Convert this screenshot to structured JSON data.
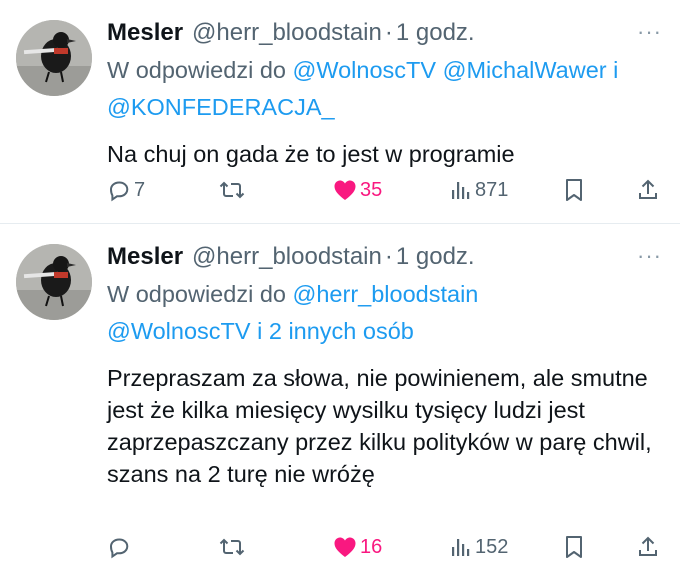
{
  "tweets": [
    {
      "author_name": "Mesler",
      "handle": "@herr_bloodstain",
      "separator": "·",
      "time": "1 godz.",
      "more_label": "···",
      "reply_prefix": "W odpowiedzi do ",
      "reply_mentions_line1": "@WolnoscTV @MichalWawer i",
      "reply_mentions_line2": "@KONFEDERACJA_",
      "text": "Na chuj on gada że to jest w programie",
      "reply_count": "7",
      "retweet_count": "",
      "like_count": "35",
      "view_count": "871",
      "liked": true
    },
    {
      "author_name": "Mesler",
      "handle": "@herr_bloodstain",
      "separator": "·",
      "time": "1 godz.",
      "more_label": "···",
      "reply_prefix": "W odpowiedzi do ",
      "reply_mentions_line1": "@herr_bloodstain",
      "reply_mentions_line2": "@WolnoscTV i 2 innych osób",
      "text": "Przepraszam za słowa, nie powinienem, ale smutne jest że kilka miesięcy wysilku tysięcy ludzi  jest zaprzepaszczany przez kilku polityków w parę chwil, szans na 2 turę nie wróżę",
      "reply_count": "",
      "retweet_count": "",
      "like_count": "16",
      "view_count": "152",
      "liked": true
    }
  ],
  "colors": {
    "accent": "#1d9bf0",
    "like": "#f91880",
    "muted": "#536471",
    "text": "#0f1419"
  },
  "icons": [
    "reply-icon",
    "retweet-icon",
    "heart-icon",
    "views-icon",
    "bookmark-icon",
    "share-icon",
    "more-icon"
  ]
}
